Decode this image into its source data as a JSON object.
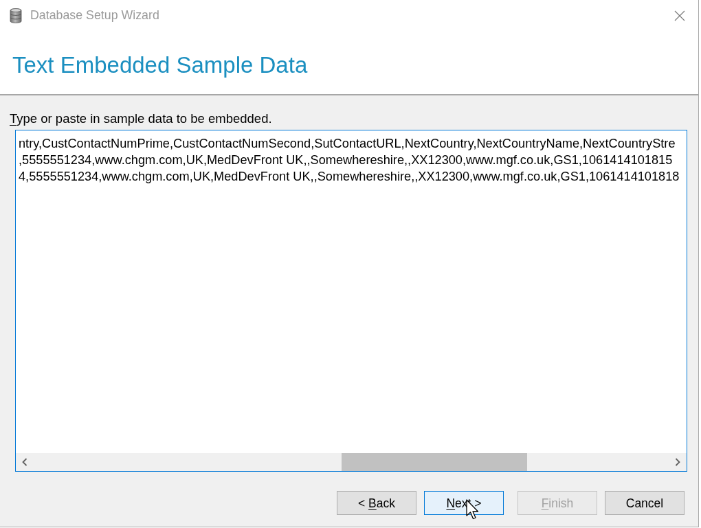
{
  "window": {
    "title": "Database Setup Wizard"
  },
  "page": {
    "heading": "Text Embedded Sample Data"
  },
  "prompt": {
    "parts": [
      {
        "text": "T",
        "underlined": true
      },
      {
        "text": "ype or paste in sample data to be embedded.",
        "underlined": false
      }
    ]
  },
  "sample_data": {
    "lines": [
      "ntry,CustContactNumPrime,CustContactNumSecond,SutContactURL,NextCountry,NextCountryName,NextCountryStre",
      ",5555551234,www.chgm.com,UK,MedDevFront UK,,Somewhereshire,,XX12300,www.mgf.co.uk,GS1,1061414101815",
      "4,5555551234,www.chgm.com,UK,MedDevFront UK,,Somewhereshire,,XX12300,www.mgf.co.uk,GS1,1061414101818"
    ]
  },
  "buttons": [
    {
      "parts": [
        {
          "text": "< ",
          "underlined": false
        },
        {
          "text": "B",
          "underlined": true
        },
        {
          "text": "ack",
          "underlined": false
        }
      ],
      "hovered": false,
      "disabled": false
    },
    {
      "parts": [
        {
          "text": "N",
          "underlined": true
        },
        {
          "text": "ext >",
          "underlined": false
        }
      ],
      "hovered": true,
      "disabled": false
    },
    {
      "parts": [
        {
          "text": "F",
          "underlined": true
        },
        {
          "text": "inish",
          "underlined": false
        }
      ],
      "hovered": false,
      "disabled": true
    },
    {
      "parts": [
        {
          "text": "Cancel",
          "underlined": false
        }
      ],
      "hovered": false,
      "disabled": false
    }
  ]
}
